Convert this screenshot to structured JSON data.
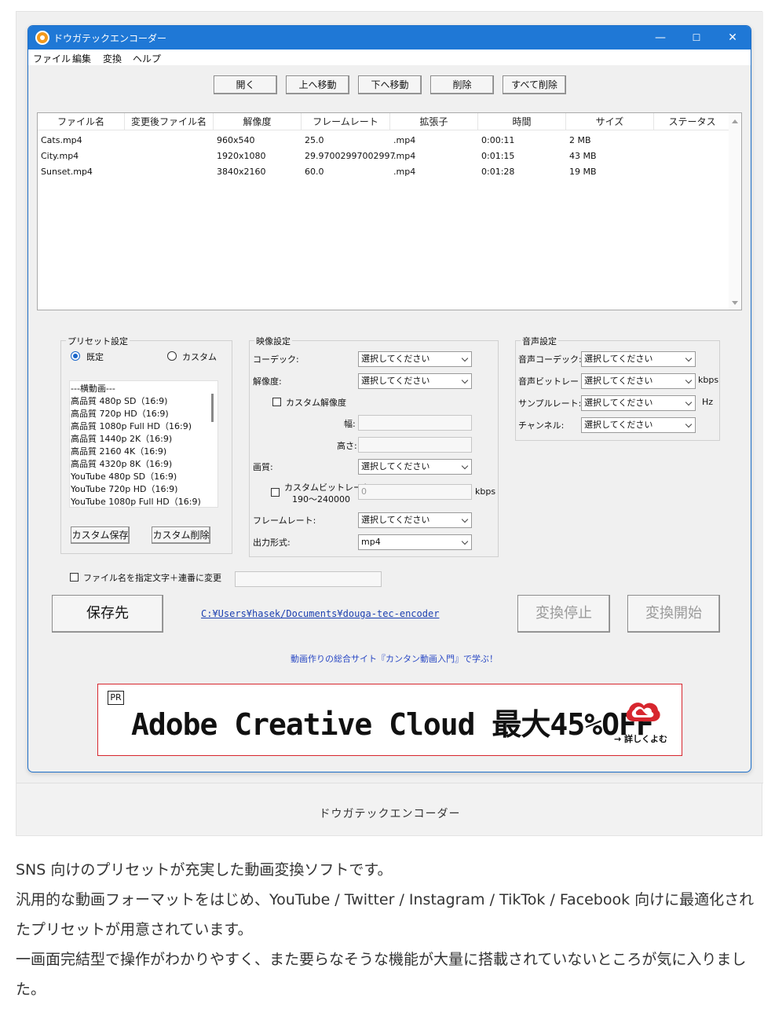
{
  "app": {
    "title": "ドウガテックエンコーダー",
    "window_controls": {
      "minimize": "—",
      "maximize": "☐",
      "close": "✕"
    }
  },
  "menu": [
    "ファイル",
    "編集",
    "変換",
    "ヘルプ"
  ],
  "toolbar": {
    "open": "開く",
    "move_up": "上へ移動",
    "move_down": "下へ移動",
    "delete": "削除",
    "delete_all": "すべて削除"
  },
  "file_list": {
    "columns": [
      "ファイル名",
      "変更後ファイル名",
      "解像度",
      "フレームレート",
      "拡張子",
      "時間",
      "サイズ",
      "ステータス"
    ],
    "rows": [
      {
        "name": "Cats.mp4",
        "renamed": "",
        "resolution": "960x540",
        "framerate": "25.0",
        "ext": ".mp4",
        "time": "0:00:11",
        "size": "2 MB",
        "status": ""
      },
      {
        "name": "City.mp4",
        "renamed": "",
        "resolution": "1920x1080",
        "framerate": "29.97002997002997",
        "ext": ".mp4",
        "time": "0:01:15",
        "size": "43 MB",
        "status": ""
      },
      {
        "name": "Sunset.mp4",
        "renamed": "",
        "resolution": "3840x2160",
        "framerate": "60.0",
        "ext": ".mp4",
        "time": "0:01:28",
        "size": "19 MB",
        "status": ""
      }
    ]
  },
  "preset": {
    "group_title": "プリセット設定",
    "radio_default": "既定",
    "radio_custom": "カスタム",
    "selected": "既定",
    "items": [
      "---横動画---",
      "高品質 480p SD（16:9)",
      "高品質 720p HD（16:9)",
      "高品質 1080p Full HD（16:9)",
      "高品質 1440p 2K（16:9)",
      "高品質 2160 4K（16:9)",
      "高品質 4320p 8K（16:9)",
      "YouTube 480p SD（16:9)",
      "YouTube 720p HD（16:9)",
      "YouTube 1080p Full HD（16:9)"
    ],
    "save_custom": "カスタム保存",
    "delete_custom": "カスタム削除"
  },
  "video": {
    "group_title": "映像設定",
    "codec_label": "コーデック:",
    "codec_value": "選択してください",
    "resolution_label": "解像度:",
    "resolution_value": "選択してください",
    "custom_resolution_label": "カスタム解像度",
    "width_label": "幅:",
    "height_label": "高さ:",
    "quality_label": "画質:",
    "quality_value": "選択してください",
    "custom_bitrate_label": "カスタムビットレート",
    "custom_bitrate_range": "190〜240000",
    "bitrate_value": "0",
    "bitrate_unit": "kbps",
    "framerate_label": "フレームレート:",
    "framerate_value": "選択してください",
    "format_label": "出力形式:",
    "format_value": "mp4"
  },
  "audio": {
    "group_title": "音声設定",
    "codec_label": "音声コーデック:",
    "codec_value": "選択してください",
    "bitrate_label": "音声ビットレート:",
    "bitrate_value": "選択してください",
    "bitrate_unit": "kbps",
    "samplerate_label": "サンプルレート:",
    "samplerate_value": "選択してください",
    "samplerate_unit": "Hz",
    "channel_label": "チャンネル:",
    "channel_value": "選択してください"
  },
  "rename": {
    "label": "ファイル名を指定文字＋連番に変更",
    "value": ""
  },
  "output": {
    "save_dest_button": "保存先",
    "path": "C:¥Users¥hasek/Documents¥douga-tec-encoder",
    "stop_button": "変換停止",
    "start_button": "変換開始"
  },
  "promo_link": "動画作りの総合サイト『カンタン動画入門』で学ぶ！",
  "banner": {
    "pr": "PR",
    "text": "Adobe Creative Cloud 最大45%OFF",
    "more": "→ 詳しくよむ",
    "accent": "#d7262e"
  },
  "caption": "ドウガテックエンコーダー",
  "article": [
    "SNS 向けのプリセットが充実した動画変換ソフトです。",
    "汎用的な動画フォーマットをはじめ、YouTube / Twitter / Instagram / TikTok / Facebook 向けに最適化されたプリセットが用意されています。",
    "一画面完結型で操作がわかりやすく、また要らなそうな機能が大量に搭載されていないところが気に入りました。"
  ],
  "colors": {
    "titlebar": "#1f78d6",
    "link": "#1b3fb0",
    "radio_selected": "#1a66c9"
  }
}
